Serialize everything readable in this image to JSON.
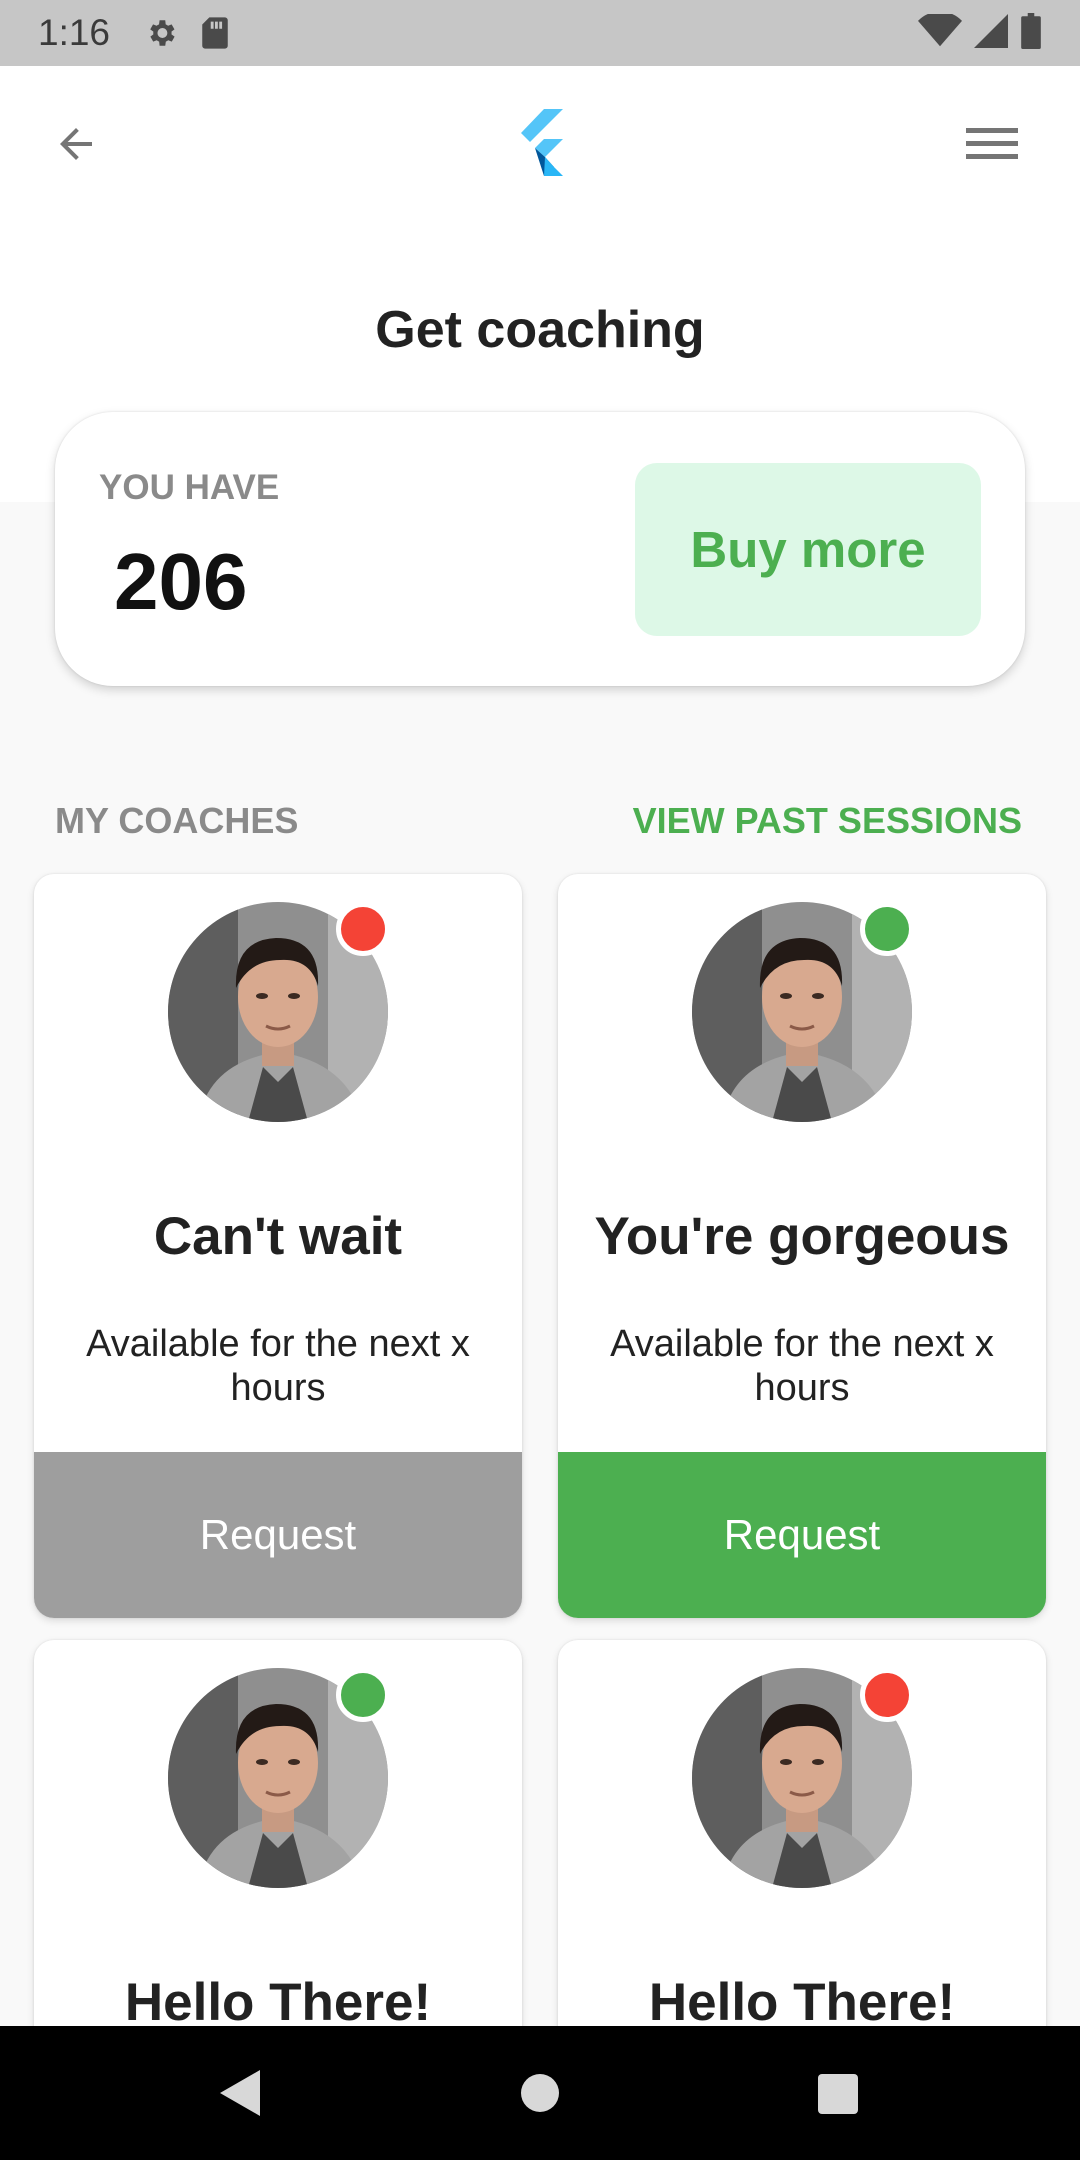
{
  "status_bar": {
    "time": "1:16"
  },
  "header": {
    "title": "Get coaching"
  },
  "credits": {
    "label": "YOU HAVE",
    "value": "206",
    "buy_label": "Buy more"
  },
  "sections": {
    "my_coaches": "MY COACHES",
    "view_past": "VIEW PAST SESSIONS"
  },
  "coaches": [
    {
      "name": "Can't wait",
      "availability": "Available for the next x hours",
      "request_label": "Request",
      "status": "busy",
      "status_color": "#f44336",
      "button_color": "#9e9e9e"
    },
    {
      "name": "You're gorgeous",
      "availability": "Available for the next x hours",
      "request_label": "Request",
      "status": "available",
      "status_color": "#4caf50",
      "button_color": "#4caf50"
    },
    {
      "name": "Hello There!",
      "status": "available",
      "status_color": "#4caf50"
    },
    {
      "name": "Hello There!",
      "status": "busy",
      "status_color": "#f44336"
    }
  ],
  "colors": {
    "accent_green": "#4caf50",
    "light_green": "#ddf8e7",
    "busy_red": "#f44336",
    "disabled_grey": "#9e9e9e"
  },
  "icons": {
    "back": "arrow-back-icon",
    "logo": "flutter-logo",
    "menu": "hamburger-menu-icon"
  }
}
